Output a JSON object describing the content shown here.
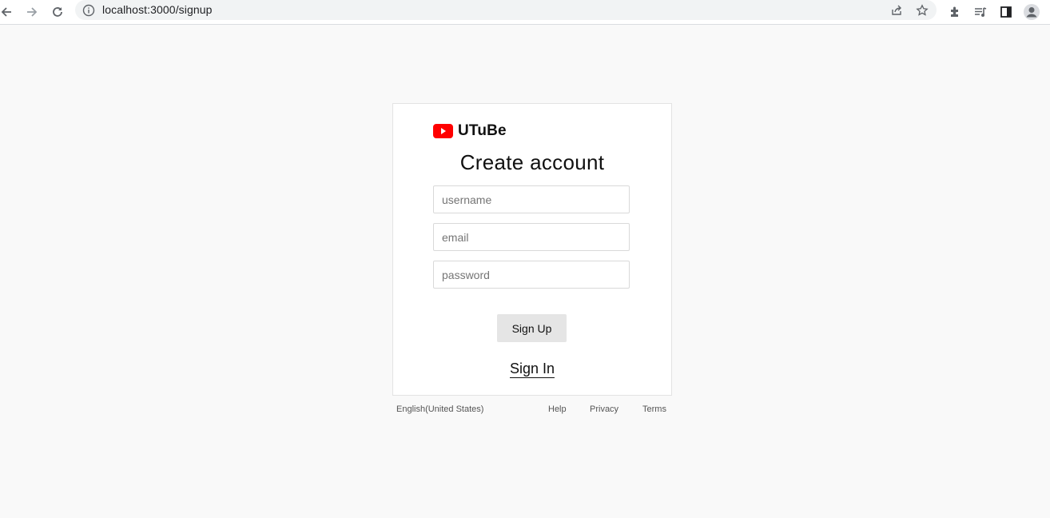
{
  "browser": {
    "url": "localhost:3000/signup"
  },
  "brand": {
    "name": "UTuBe",
    "logo_color": "#ff0000"
  },
  "form": {
    "title": "Create account",
    "username_placeholder": "username",
    "email_placeholder": "email",
    "password_placeholder": "password",
    "submit_label": "Sign Up",
    "signin_label": "Sign In"
  },
  "footer": {
    "language": "English(United States)",
    "help": "Help",
    "privacy": "Privacy",
    "terms": "Terms"
  }
}
